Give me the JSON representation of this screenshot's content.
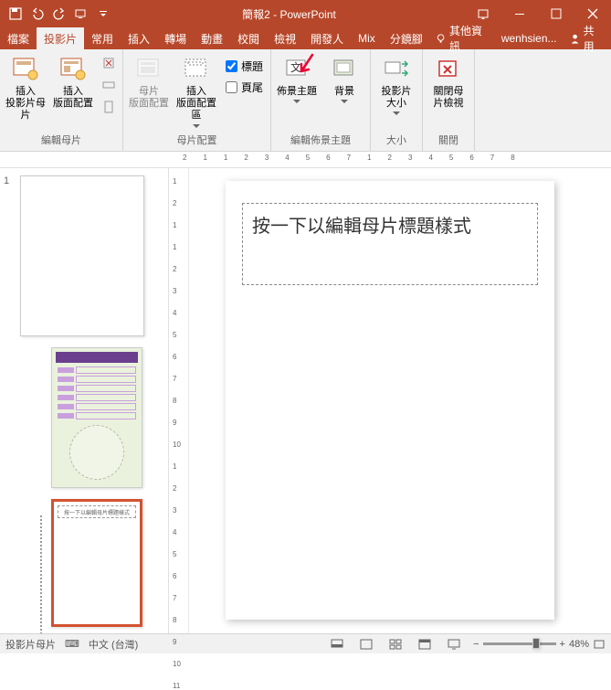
{
  "titlebar": {
    "title": "簡報2 - PowerPoint"
  },
  "tabs": {
    "file": "檔案",
    "slide": "投影片",
    "home": "常用",
    "insert": "插入",
    "transitions": "轉場",
    "animations": "動畫",
    "review": "校閱",
    "view": "檢視",
    "developer": "開發人",
    "mix": "Mix",
    "split": "分鏡腳",
    "tell": "其他資訊",
    "account": "wenhsien...",
    "share": "共用"
  },
  "ribbon": {
    "group1": {
      "insert_slide_master": "插入\n投影片母片",
      "insert_layout": "插入\n版面配置",
      "label": "編輯母片"
    },
    "group2": {
      "master_layout": "母片\n版面配置",
      "insert_placeholder": "插入\n版面配置區",
      "chk_title": "標題",
      "chk_footer": "頁尾",
      "label": "母片配置"
    },
    "group3": {
      "themes": "佈景主題",
      "background": "背景",
      "label": "編輯佈景主題"
    },
    "group4": {
      "slide_size": "投影片\n大小",
      "label": "大小"
    },
    "group5": {
      "close_master": "關閉母\n片檢視",
      "label": "關閉"
    }
  },
  "ruler_h": [
    "2",
    "1",
    "1",
    "2",
    "3",
    "4",
    "5",
    "6",
    "7",
    "1",
    "2",
    "3",
    "4",
    "5",
    "6",
    "7",
    "8"
  ],
  "ruler_v": [
    "1",
    "2",
    "1",
    "1",
    "2",
    "3",
    "4",
    "5",
    "6",
    "7",
    "8",
    "9",
    "10",
    "1",
    "2",
    "3",
    "4",
    "5",
    "6",
    "7",
    "8",
    "9",
    "10",
    "11"
  ],
  "thumb": {
    "master_num": "1",
    "layout2_text": "按一下以編輯母片標題樣式"
  },
  "slide": {
    "placeholder_text": "按一下以編輯母片標題樣式"
  },
  "status": {
    "view_name": "投影片母片",
    "lang": "中文 (台灣)",
    "zoom": "48%"
  }
}
